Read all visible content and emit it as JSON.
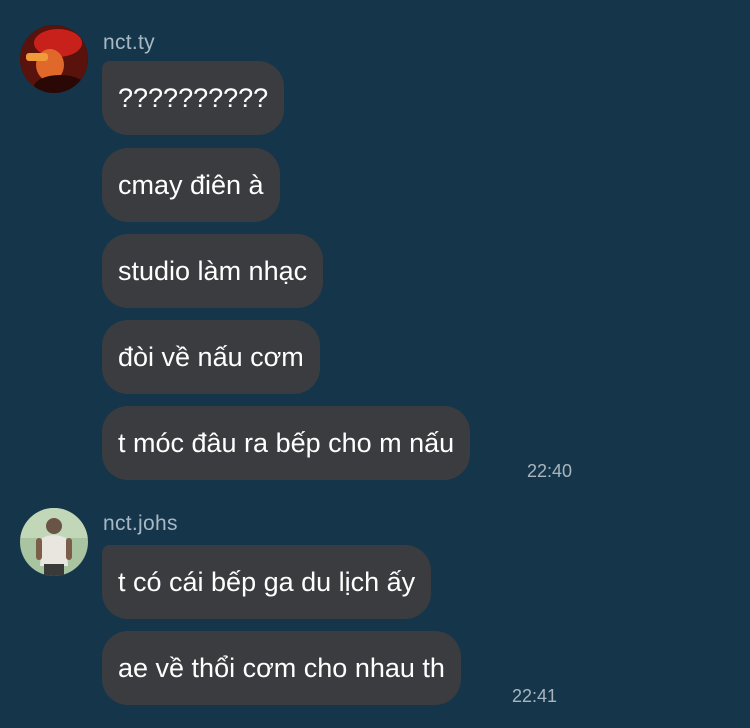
{
  "chat": {
    "groups": [
      {
        "sender": "nct.ty",
        "avatar_icon": "user-avatar-red-tint",
        "messages": [
          "??????????",
          "cmay điên à",
          "studio làm nhạc",
          "đòi về nấu cơm",
          "t móc đâu ra bếp cho m nấu"
        ],
        "time": "22:40"
      },
      {
        "sender": "nct.johs",
        "avatar_icon": "user-avatar-green-tint",
        "messages": [
          "t có cái bếp ga du lịch ấy",
          "ae về thổi cơm cho nhau th"
        ],
        "time": "22:41"
      }
    ]
  },
  "colors": {
    "background": "#15364a",
    "bubble": "#3b3c3f",
    "sender_name": "#a7b8c4",
    "timestamp": "#a9b5bd"
  }
}
